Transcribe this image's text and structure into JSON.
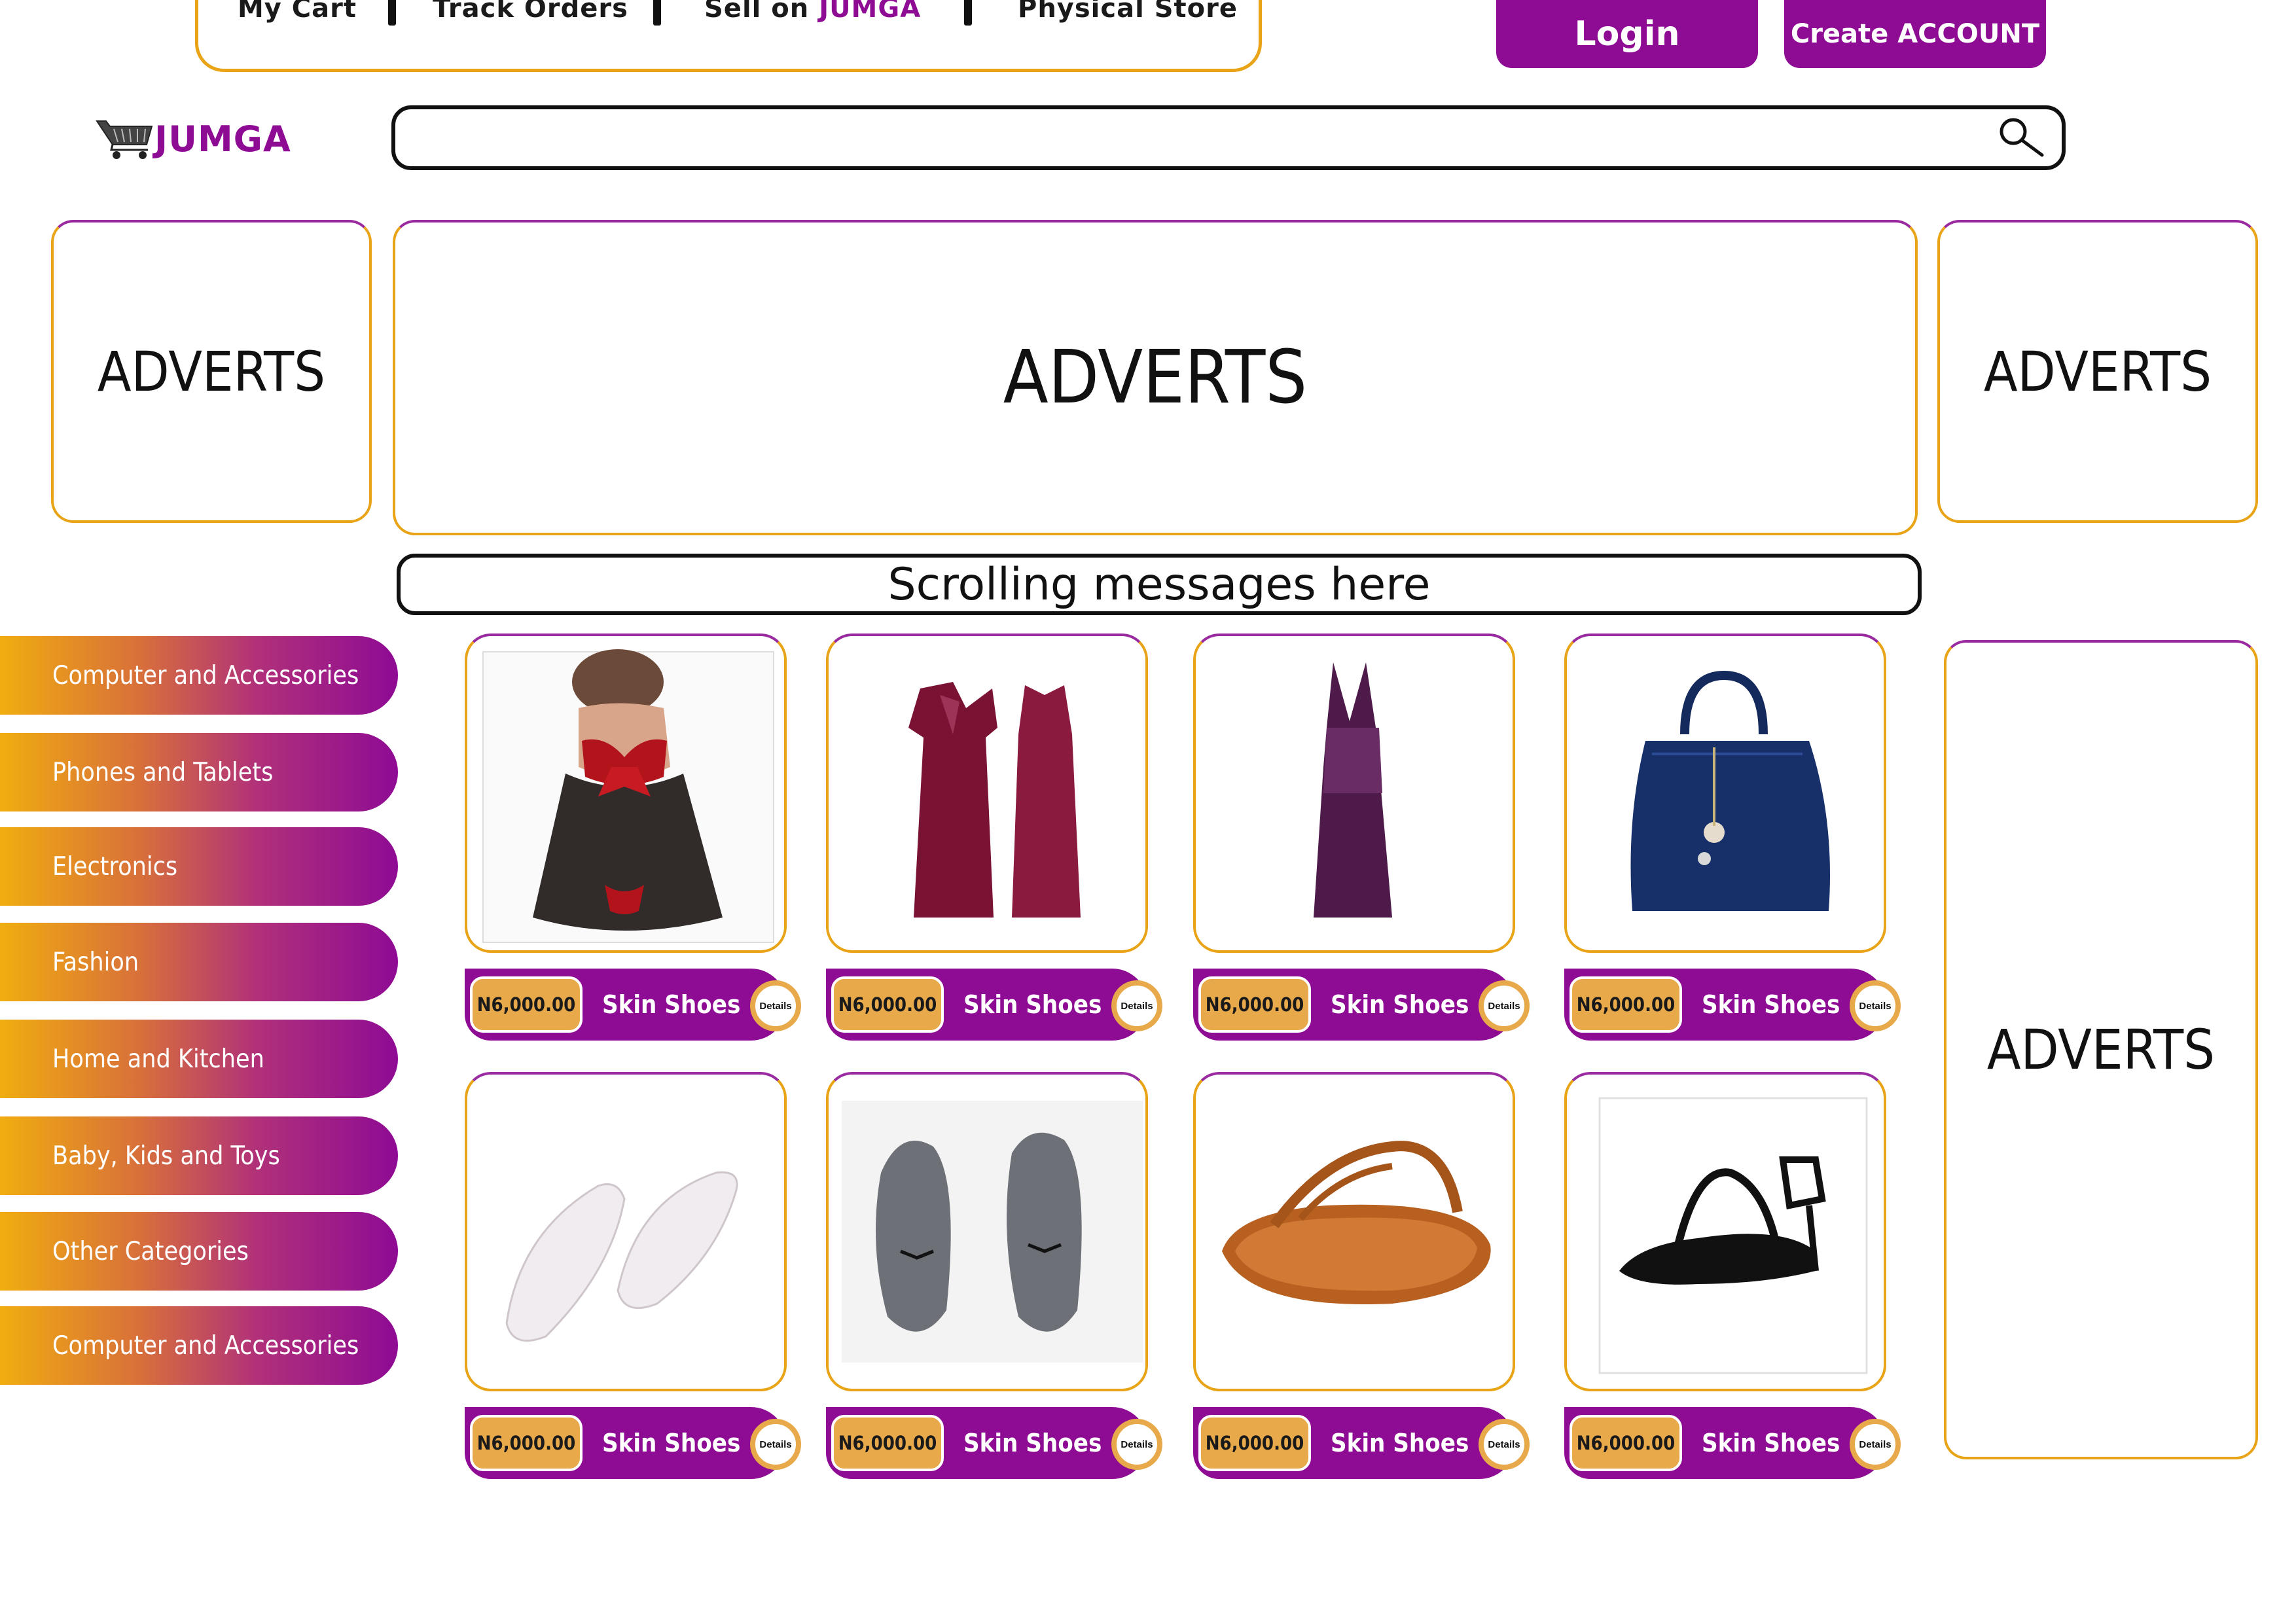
{
  "topnav": {
    "my_cart": "My Cart",
    "track_orders": "Track Orders",
    "sell_on": "Sell on",
    "sell_brand": "JUMGA",
    "physical_store": "Physical Store"
  },
  "auth": {
    "login": "Login",
    "create_account": "Create ACCOUNT"
  },
  "logo": {
    "text": "JUMGA",
    "icon": "shopping-cart-icon"
  },
  "search": {
    "placeholder": "",
    "icon": "search-icon"
  },
  "adverts": {
    "left": "ADVERTS",
    "center": "ADVERTS",
    "right": "ADVERTS",
    "side": "ADVERTS"
  },
  "scrolling_message": "Scrolling messages here",
  "categories": [
    "Computer and Accessories",
    "Phones and Tablets",
    "Electronics",
    "Fashion",
    "Home and Kitchen",
    "Baby, Kids and Toys",
    "Other Categories",
    "Computer and Accessories"
  ],
  "products": [
    {
      "price": "N6,000.00",
      "name": "Skin Shoes",
      "details": "Details",
      "image": "lingerie-red-black"
    },
    {
      "price": "N6,000.00",
      "name": "Skin Shoes",
      "details": "Details",
      "image": "nightgown-set-burgundy"
    },
    {
      "price": "N6,000.00",
      "name": "Skin Shoes",
      "details": "Details",
      "image": "lace-nightdress-purple"
    },
    {
      "price": "N6,000.00",
      "name": "Skin Shoes",
      "details": "Details",
      "image": "handbag-navy"
    },
    {
      "price": "N6,000.00",
      "name": "Skin Shoes",
      "details": "Details",
      "image": "flats-white-pearl"
    },
    {
      "price": "N6,000.00",
      "name": "Skin Shoes",
      "details": "Details",
      "image": "flats-grey"
    },
    {
      "price": "N6,000.00",
      "name": "Skin Shoes",
      "details": "Details",
      "image": "sandals-brown"
    },
    {
      "price": "N6,000.00",
      "name": "Skin Shoes",
      "details": "Details",
      "image": "sandals-black"
    }
  ],
  "colors": {
    "brand_purple": "#8e0b94",
    "accent_gold": "#e8a317",
    "price_tag": "#e8a94b"
  }
}
